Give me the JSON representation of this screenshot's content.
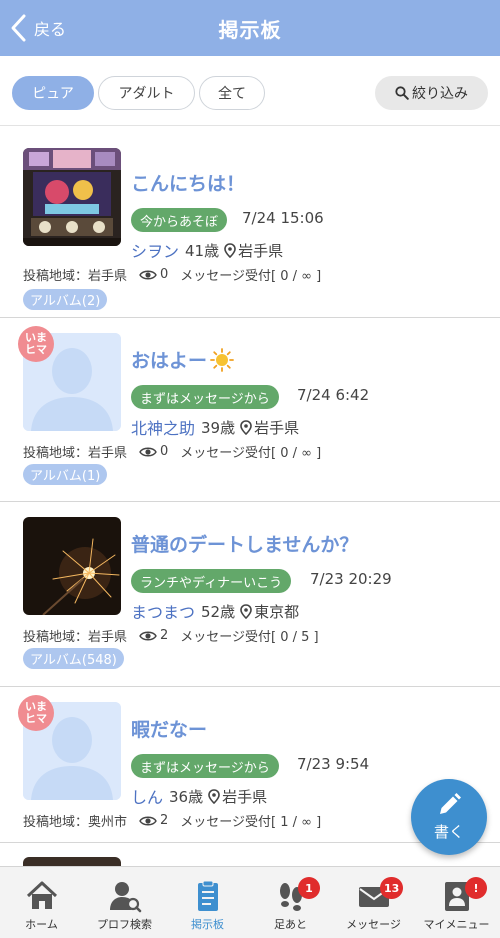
{
  "header": {
    "back_label": "戻る",
    "title": "掲示板"
  },
  "filters": {
    "pure": "ピュア",
    "adult": "アダルト",
    "all": "全て",
    "narrow": "絞り込み",
    "active": "pure"
  },
  "posts": [
    {
      "title": "こんにちは！",
      "tag": "今からあそぼ",
      "datetime": "7/24 15:06",
      "name": "シヲン",
      "age": "41歳",
      "prefecture": "岩手県",
      "area": "投稿地域：岩手県",
      "views": "0",
      "message_accept": "メッセージ受付[ 0 / ∞ ]",
      "album": "アルバム(2)",
      "imahima": false,
      "thumbnail": "photo-slot-machine"
    },
    {
      "title": "おはよー",
      "title_emoji": "sun-icon",
      "tag": "まずはメッセージから",
      "datetime": "7/24 6:42",
      "name": "北神之助",
      "age": "39歳",
      "prefecture": "岩手県",
      "area": "投稿地域：岩手県",
      "views": "0",
      "message_accept": "メッセージ受付[ 0 / ∞ ]",
      "album": "アルバム(1)",
      "imahima": true,
      "imahima_label_1": "いま",
      "imahima_label_2": "ヒマ",
      "thumbnail": "default-avatar"
    },
    {
      "title": "普通のデートしませんか？",
      "tag": "ランチやディナーいこう",
      "datetime": "7/23 20:29",
      "name": "まつまつ",
      "age": "52歳",
      "prefecture": "東京都",
      "area": "投稿地域：岩手県",
      "views": "2",
      "message_accept": "メッセージ受付[ 0 / 5 ]",
      "album": "アルバム(548)",
      "imahima": false,
      "thumbnail": "photo-sparkler"
    },
    {
      "title": "暇だなー",
      "tag": "まずはメッセージから",
      "datetime": "7/23 9:54",
      "name": "しん",
      "age": "36歳",
      "prefecture": "岩手県",
      "area": "投稿地域：奥州市",
      "views": "2",
      "message_accept": "メッセージ受付[ 1 / ∞ ]",
      "imahima": true,
      "imahima_label_1": "いま",
      "imahima_label_2": "ヒマ",
      "thumbnail": "default-avatar"
    }
  ],
  "fab": {
    "label": "書く",
    "icon": "pencil-icon"
  },
  "bottom_nav": [
    {
      "label": "ホーム",
      "icon": "home-icon"
    },
    {
      "label": "プロフ検索",
      "icon": "profile-search-icon"
    },
    {
      "label": "掲示板",
      "icon": "board-icon",
      "active": true
    },
    {
      "label": "足あと",
      "icon": "footprint-icon",
      "badge": "1"
    },
    {
      "label": "メッセージ",
      "icon": "mail-icon",
      "badge": "13"
    },
    {
      "label": "マイメニュー",
      "icon": "my-menu-icon",
      "badge": "!"
    }
  ],
  "colors": {
    "header": "#8fb0e6",
    "tag": "#63a86a",
    "title": "#6d93d6",
    "user_name": "#4d72c2",
    "album": "#aec7ef",
    "badge": "#e02c2c",
    "fab": "#3e8fcf",
    "imahima": "#f08c91"
  }
}
